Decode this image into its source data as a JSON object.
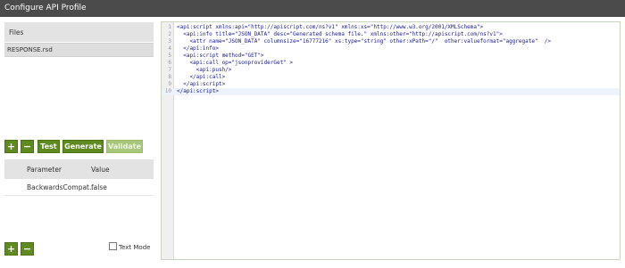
{
  "window": {
    "title": "Configure API Profile"
  },
  "files": {
    "header": "Files",
    "items": [
      "RESPONSE.rsd"
    ]
  },
  "toolbar": {
    "add": "+",
    "remove": "−",
    "test": "Test",
    "generate": "Generate",
    "validate": "Validate"
  },
  "params": {
    "headers": [
      "Parameter",
      "Value"
    ],
    "rows": [
      {
        "name": "BackwardsCompat...",
        "value": "false"
      }
    ]
  },
  "bottom": {
    "add": "+",
    "remove": "−",
    "text_mode_label": "Text Mode",
    "text_mode_checked": false
  },
  "editor": {
    "lines": [
      {
        "n": "1",
        "text": "<api:script xmlns:api=\"http://apiscript.com/ns?v1\" xmlns:xs=\"http://www.w3.org/2001/XMLSchema\">"
      },
      {
        "n": "2",
        "text": "  <api:info title=\"JSON_DATA\" desc=\"Generated schema file.\" xmlns:other=\"http://apiscript.com/ns?v1\">"
      },
      {
        "n": "3",
        "text": "    <attr name=\"JSON_DATA\" columnsize=\"16777216\" xs:type=\"string\" other:xPath=\"/\"  other:valueformat=\"aggregate\"  />"
      },
      {
        "n": "4",
        "text": "  </api:info>"
      },
      {
        "n": "5",
        "text": "  <api:script method=\"GET\">"
      },
      {
        "n": "6",
        "text": "    <api:call op=\"jsonproviderGet\" >"
      },
      {
        "n": "7",
        "text": "      <api:push/>"
      },
      {
        "n": "8",
        "text": "    </api:call>"
      },
      {
        "n": "9",
        "text": "  </api:script>"
      },
      {
        "n": "10",
        "text": "</api:script>"
      }
    ]
  },
  "colors": {
    "accent_green": "#5e8a1f",
    "titlebar": "#4b4b4b",
    "code_text": "#1a1a8e"
  }
}
